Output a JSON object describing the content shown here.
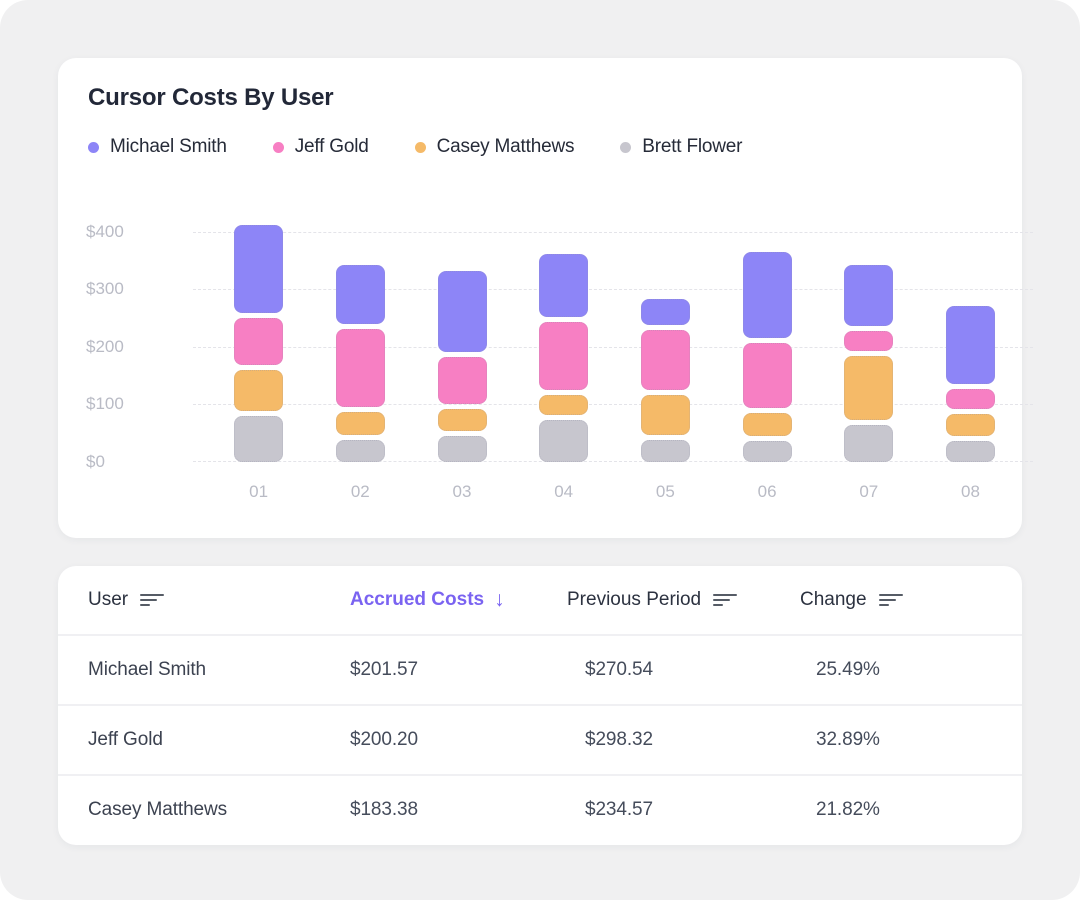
{
  "chart_card": {
    "title": "Cursor Costs By User",
    "legend": [
      {
        "label": "Michael Smith",
        "color": "#8d85f7"
      },
      {
        "label": "Jeff Gold",
        "color": "#f77fc3"
      },
      {
        "label": "Casey Matthews",
        "color": "#f5ba68"
      },
      {
        "label": "Brett Flower",
        "color": "#c7c6ce"
      }
    ]
  },
  "chart_data": {
    "type": "bar",
    "stacked": true,
    "title": "Cursor Costs By User",
    "categories": [
      "01",
      "02",
      "03",
      "04",
      "05",
      "06",
      "07",
      "08"
    ],
    "series": [
      {
        "name": "Brett Flower",
        "color": "#c7c6ce",
        "values": [
          80,
          39,
          46,
          73,
          38,
          36,
          64,
          36
        ]
      },
      {
        "name": "Casey Matthews",
        "color": "#f5ba68",
        "values": [
          72,
          39,
          37,
          35,
          70,
          40,
          111,
          38
        ]
      },
      {
        "name": "Jeff Gold",
        "color": "#f77fc3",
        "values": [
          81,
          136,
          83,
          118,
          104,
          114,
          36,
          36
        ]
      },
      {
        "name": "Michael Smith",
        "color": "#8d85f7",
        "values": [
          153,
          102,
          141,
          109,
          46,
          149,
          105,
          135
        ]
      }
    ],
    "stack_order": "bottom-to-top",
    "ylabel_ticks": [
      "$0",
      "$100",
      "$200",
      "$300",
      "$400"
    ],
    "ylim": [
      0,
      400
    ],
    "grid": "dashed-horizontal",
    "legend_position": "top-left"
  },
  "table": {
    "header": {
      "user": "User",
      "accrued": "Accrued Costs",
      "previous": "Previous Period",
      "change": "Change",
      "sort_arrow": "↓",
      "active_sort_column": "Accrued Costs"
    },
    "rows": [
      {
        "user": "Michael Smith",
        "accrued": "$201.57",
        "previous": "$270.54",
        "change": "25.49%"
      },
      {
        "user": "Jeff Gold",
        "accrued": "$200.20",
        "previous": "$298.32",
        "change": "32.89%"
      },
      {
        "user": "Casey Matthews",
        "accrued": "$183.38",
        "previous": "$234.57",
        "change": "21.82%"
      }
    ]
  },
  "colors": {
    "accent": "#7a63f1",
    "background": "#f0f0f1",
    "card": "#ffffff",
    "axis_text": "#b9bbc5"
  }
}
